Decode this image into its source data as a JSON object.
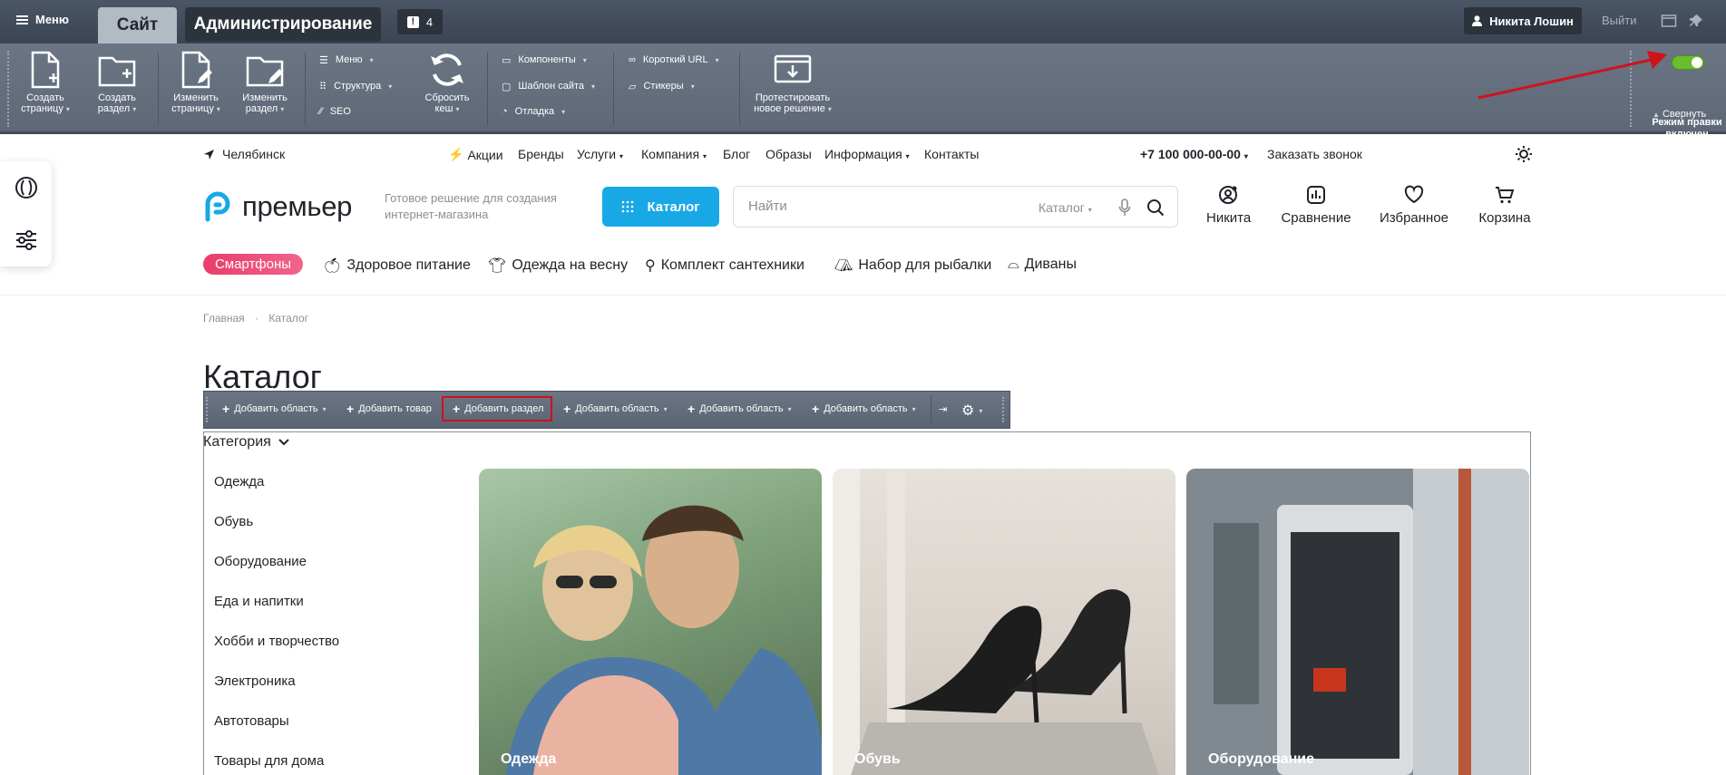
{
  "admin_bar": {
    "menu_label": "Меню",
    "tab_site": "Сайт",
    "tab_admin": "Администрирование",
    "notifications_count": "4",
    "user_name": "Никита Лошин",
    "logout": "Выйти"
  },
  "admin_panel": {
    "create_page": [
      "Создать",
      "страницу"
    ],
    "create_section": [
      "Создать",
      "раздел"
    ],
    "edit_page": [
      "Изменить",
      "страницу"
    ],
    "edit_section": [
      "Изменить",
      "раздел"
    ],
    "menu": "Меню",
    "structure": "Структура",
    "seo": "SEO",
    "reset_cache": [
      "Сбросить",
      "кеш"
    ],
    "components": "Компоненты",
    "site_template": "Шаблон сайта",
    "debug": "Отладка",
    "short_url": "Короткий URL",
    "stickers": "Стикеры",
    "test_solution": [
      "Протестировать",
      "новое решение"
    ],
    "edit_mode": [
      "Режим правки",
      "включен"
    ],
    "collapse": "Свернуть"
  },
  "header": {
    "city": "Челябинск",
    "nav": [
      "Акции",
      "Бренды",
      "Услуги",
      "Компания",
      "Блог",
      "Образы",
      "Информация",
      "Контакты"
    ],
    "phone": "+7 100 000-00-00",
    "callback": "Заказать звонок",
    "logo_text": "премьер",
    "tagline": "Готовое решение для создания интернет-магазина",
    "catalog_button": "Каталог",
    "search_placeholder": "Найти",
    "search_scope": "Каталог",
    "icons": {
      "user": "Никита",
      "compare": "Сравнение",
      "favorites": "Избранное",
      "cart": "Корзина"
    }
  },
  "tags": {
    "highlight": "Смартфоны",
    "items": [
      "Здоровое питание",
      "Одежда на весну",
      "Комплект сантехники",
      "Набор для рыбалки",
      "Диваны"
    ]
  },
  "breadcrumbs": [
    "Главная",
    "Каталог"
  ],
  "page_title": "Каталог",
  "edit_toolbar": {
    "add_area": "Добавить область",
    "add_product": "Добавить товар",
    "add_section": "Добавить раздел"
  },
  "categories": {
    "title": "Категория",
    "items": [
      "Одежда",
      "Обувь",
      "Оборудование",
      "Еда и напитки",
      "Хобби и творчество",
      "Электроника",
      "Автотовары",
      "Товары для дома"
    ]
  },
  "cards": [
    "Одежда",
    "Обувь",
    "Оборудование"
  ],
  "colors": {
    "accent": "#19a8e6",
    "pill": "#e93d6a",
    "toggle_on": "#6cbd2e",
    "highlight_border": "#d0121b"
  }
}
